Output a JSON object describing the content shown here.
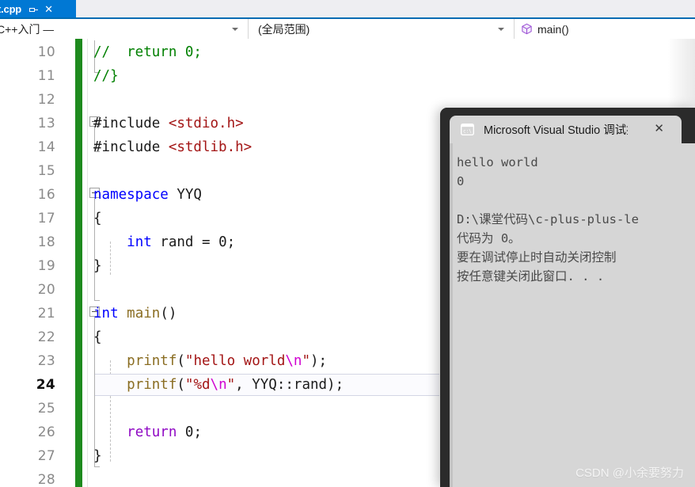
{
  "window": {
    "tab": {
      "label": "t.cpp",
      "pin_icon": "pin-icon",
      "close_icon": "close-icon"
    }
  },
  "navbar": {
    "project_combo": {
      "value": "C++入门 —",
      "arrow_icon": "chevron-down-icon"
    },
    "scope_combo": {
      "value": "(全局范围)",
      "arrow_icon": "chevron-down-icon"
    },
    "member_combo": {
      "value": "main()",
      "icon": "method-cube-icon"
    }
  },
  "editor": {
    "current_line": 24,
    "colors": {
      "keyword": "#0000ff",
      "keyword2": "#8f08c4",
      "comment": "#008000",
      "string": "#a31515",
      "escape": "#d000d0",
      "function": "#8a6d22",
      "header": "#a31515",
      "change_bar": "#1e8a1e"
    },
    "lines": [
      {
        "n": "10",
        "tokens": [
          {
            "t": "//  return 0;",
            "c": "t-comment"
          }
        ]
      },
      {
        "n": "11",
        "tokens": [
          {
            "t": "//}",
            "c": "t-comment"
          }
        ]
      },
      {
        "n": "12",
        "tokens": []
      },
      {
        "n": "13",
        "tokens": [
          {
            "t": "#include ",
            "c": "t-pp"
          },
          {
            "t": "<stdio.h>",
            "c": "t-header"
          }
        ]
      },
      {
        "n": "14",
        "tokens": [
          {
            "t": "#include ",
            "c": "t-pp"
          },
          {
            "t": "<stdlib.h>",
            "c": "t-header"
          }
        ]
      },
      {
        "n": "15",
        "tokens": []
      },
      {
        "n": "16",
        "tokens": [
          {
            "t": "namespace",
            "c": "t-kw"
          },
          {
            "t": " YYQ",
            "c": "t-plain"
          }
        ]
      },
      {
        "n": "17",
        "tokens": [
          {
            "t": "{",
            "c": "t-plain"
          }
        ]
      },
      {
        "n": "18",
        "tokens": [
          {
            "t": "    ",
            "c": "t-plain"
          },
          {
            "t": "int",
            "c": "t-kw"
          },
          {
            "t": " rand = ",
            "c": "t-plain"
          },
          {
            "t": "0",
            "c": "t-num"
          },
          {
            "t": ";",
            "c": "t-plain"
          }
        ]
      },
      {
        "n": "19",
        "tokens": [
          {
            "t": "}",
            "c": "t-plain"
          }
        ]
      },
      {
        "n": "20",
        "tokens": []
      },
      {
        "n": "21",
        "tokens": [
          {
            "t": "int",
            "c": "t-kw"
          },
          {
            "t": " ",
            "c": "t-plain"
          },
          {
            "t": "main",
            "c": "t-fn"
          },
          {
            "t": "()",
            "c": "t-plain"
          }
        ]
      },
      {
        "n": "22",
        "tokens": [
          {
            "t": "{",
            "c": "t-plain"
          }
        ]
      },
      {
        "n": "23",
        "tokens": [
          {
            "t": "    ",
            "c": "t-plain"
          },
          {
            "t": "printf",
            "c": "t-fn"
          },
          {
            "t": "(",
            "c": "t-plain"
          },
          {
            "t": "\"hello world",
            "c": "t-str"
          },
          {
            "t": "\\n",
            "c": "t-esc"
          },
          {
            "t": "\"",
            "c": "t-str"
          },
          {
            "t": ");",
            "c": "t-plain"
          }
        ]
      },
      {
        "n": "24",
        "tokens": [
          {
            "t": "    ",
            "c": "t-plain"
          },
          {
            "t": "printf",
            "c": "t-fn"
          },
          {
            "t": "(",
            "c": "t-plain"
          },
          {
            "t": "\"%d",
            "c": "t-str"
          },
          {
            "t": "\\n",
            "c": "t-esc"
          },
          {
            "t": "\"",
            "c": "t-str"
          },
          {
            "t": ", YYQ::rand);",
            "c": "t-plain"
          }
        ]
      },
      {
        "n": "25",
        "tokens": []
      },
      {
        "n": "26",
        "tokens": [
          {
            "t": "    ",
            "c": "t-plain"
          },
          {
            "t": "return",
            "c": "t-kw2"
          },
          {
            "t": " ",
            "c": "t-plain"
          },
          {
            "t": "0",
            "c": "t-num"
          },
          {
            "t": ";",
            "c": "t-plain"
          }
        ]
      },
      {
        "n": "27",
        "tokens": [
          {
            "t": "}",
            "c": "t-plain"
          }
        ]
      },
      {
        "n": "28",
        "tokens": []
      }
    ]
  },
  "console": {
    "title": "Microsoft Visual Studio 调试控",
    "icon": "cmd-prompt-icon",
    "close_icon": "close-icon",
    "output": "hello world\n0\n\nD:\\课堂代码\\c-plus-plus-le\n代码为 0。\n要在调试停止时自动关闭控制\n按任意键关闭此窗口. . ."
  },
  "watermark": {
    "text": "CSDN @小余要努力"
  }
}
